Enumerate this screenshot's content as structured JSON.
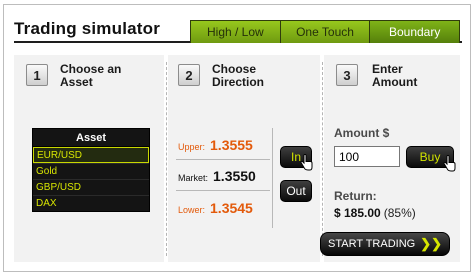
{
  "title": "Trading simulator",
  "tabs": [
    {
      "label": "High / Low",
      "active": false
    },
    {
      "label": "One Touch",
      "active": false
    },
    {
      "label": "Boundary",
      "active": true
    }
  ],
  "steps": [
    {
      "number": "1",
      "label": "Choose an\nAsset"
    },
    {
      "number": "2",
      "label": "Choose\nDirection"
    },
    {
      "number": "3",
      "label": "Enter\nAmount"
    }
  ],
  "assets": {
    "header": "Asset",
    "items": [
      "EUR/USD",
      "Gold",
      "GBP/USD",
      "DAX"
    ],
    "selected": "EUR/USD"
  },
  "direction": {
    "upper_label": "Upper:",
    "upper_value": "1.3555",
    "market_label": "Market:",
    "market_value": "1.3550",
    "lower_label": "Lower:",
    "lower_value": "1.3545",
    "in_label": "In",
    "out_label": "Out"
  },
  "amount": {
    "label": "Amount $",
    "value": "100",
    "buy_label": "Buy",
    "return_label": "Return:",
    "return_value": "$ 185.00",
    "return_pct": "(85%)",
    "start_label": "START TRADING",
    "start_icon": "double-chevron-right-icon"
  },
  "colors": {
    "tab_green": "#7fb318",
    "price_orange": "#e35a0b",
    "accent_lime": "#d2e400"
  }
}
